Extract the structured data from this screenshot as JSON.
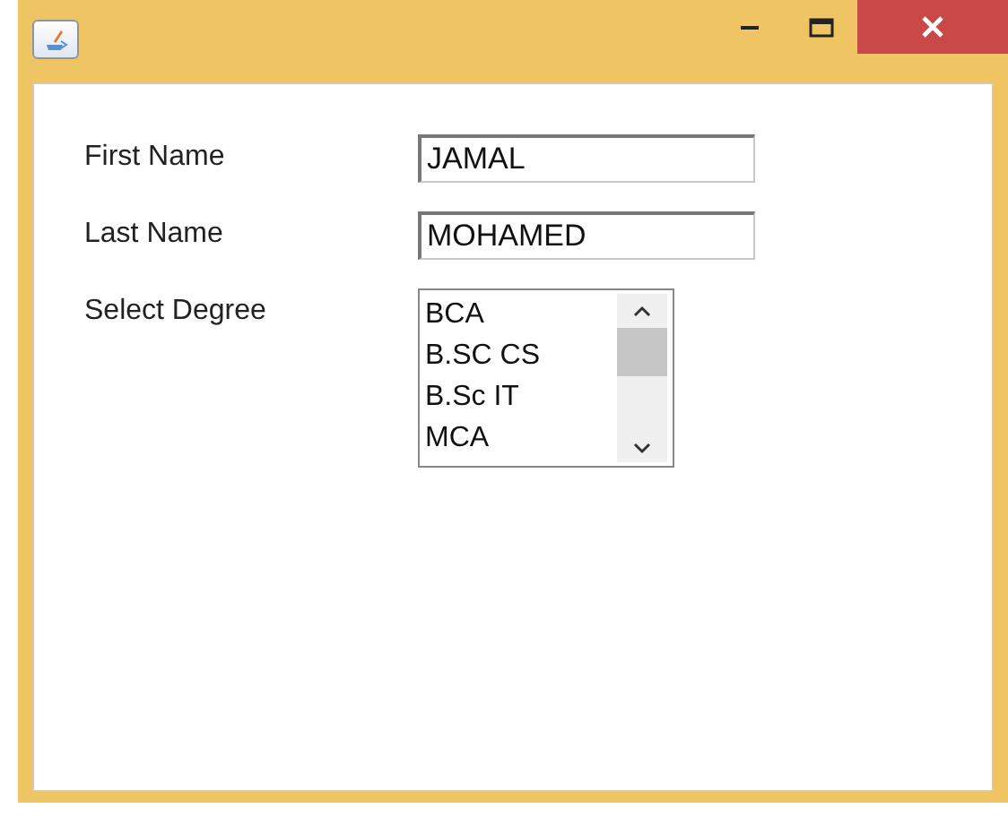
{
  "fields": [
    {
      "label": "First Name",
      "value": "JAMAL"
    },
    {
      "label": "Last Name",
      "value": "MOHAMED"
    }
  ],
  "degree": {
    "label": "Select Degree",
    "items": [
      "BCA",
      "B.SC CS",
      "B.Sc IT",
      "MCA"
    ]
  }
}
